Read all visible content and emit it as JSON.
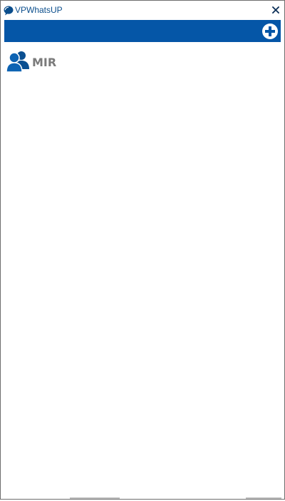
{
  "window": {
    "title": "VPWhatsUP"
  },
  "icons": {
    "app": "chat-bubble-icon",
    "close": "close-icon",
    "add": "plus-circle-icon",
    "contact": "group-users-icon"
  },
  "colors": {
    "accent": "#0556a7",
    "title_text": "#0b4e8c",
    "contact_text": "#7a7a7a"
  },
  "contacts": [
    {
      "name": "MIR"
    }
  ]
}
